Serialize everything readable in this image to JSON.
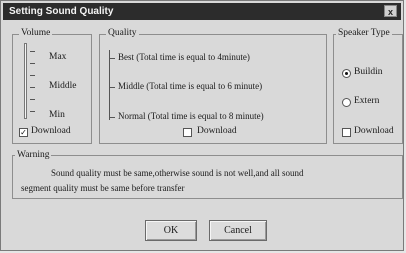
{
  "dialog": {
    "title": "Setting Sound Quality",
    "close_glyph": "x"
  },
  "volume": {
    "legend": "Volume",
    "levels": [
      "Max",
      "Middle",
      "Min"
    ],
    "download_label": "Download",
    "download_checked": true
  },
  "quality": {
    "legend": "Quality",
    "options": [
      "Best (Total time is equal to 4minute)",
      "Middle (Total time is equal to 6 minute)",
      "Normal (Total time is equal to 8 minute)"
    ],
    "download_label": "Download",
    "download_checked": false
  },
  "speaker": {
    "legend": "Speaker Type",
    "options": [
      "Buildin",
      "Extern"
    ],
    "selected": "Buildin",
    "download_label": "Download",
    "download_checked": false
  },
  "warning": {
    "legend": "Warning",
    "line1": "Sound quality must be same,otherwise sound is not well,and all sound",
    "line2": "segment quality must be same before transfer"
  },
  "buttons": {
    "ok": "OK",
    "cancel": "Cancel"
  },
  "glyphs": {
    "check": "✓"
  }
}
